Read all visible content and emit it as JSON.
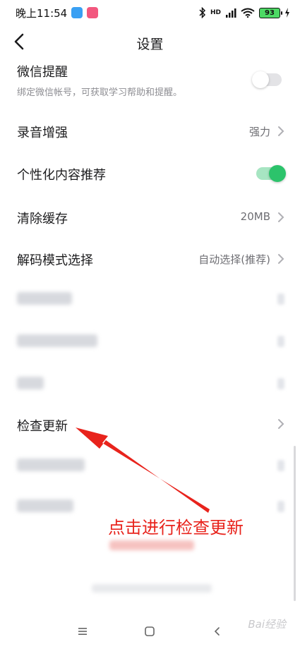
{
  "status_bar": {
    "time": "晚上11:54",
    "network": "HD",
    "battery": "93"
  },
  "nav": {
    "title": "设置"
  },
  "settings": {
    "wechat": {
      "label": "微信提醒",
      "sub": "绑定微信帐号，可获取学习帮助和提醒。",
      "enabled": false
    },
    "recording": {
      "label": "录音增强",
      "value": "强力"
    },
    "personalized": {
      "label": "个性化内容推荐",
      "enabled": true
    },
    "cache": {
      "label": "清除缓存",
      "value": "20MB"
    },
    "decode": {
      "label": "解码模式选择",
      "value": "自动选择(推荐)"
    },
    "update": {
      "label": "检查更新"
    }
  },
  "annotation": {
    "text": "点击进行检查更新"
  },
  "watermark": "Bai经验",
  "colors": {
    "toggle_on": "#2cc36b",
    "annotation_red": "#e8231c",
    "text_primary": "#1c1c1e",
    "text_secondary": "#8e8e93"
  }
}
